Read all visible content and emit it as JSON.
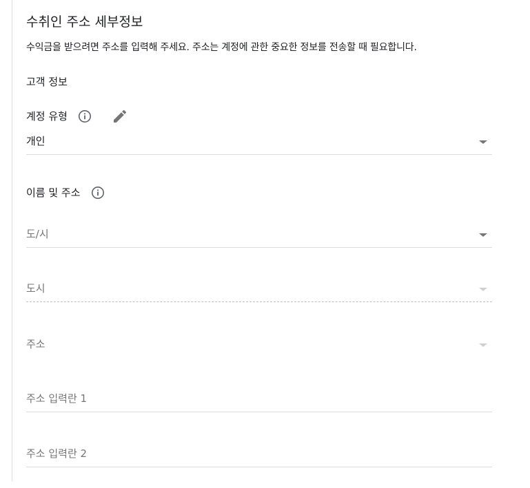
{
  "header": {
    "title": "수취인 주소 세부정보",
    "description": "수익금을 받으려면 주소를 입력해 주세요. 주소는 계정에 관한 중요한 정보를 전송할 때 필요합니다."
  },
  "customer_section": {
    "title": "고객 정보"
  },
  "account_type": {
    "label": "계정 유형",
    "value": "개인"
  },
  "name_address": {
    "label": "이름 및 주소"
  },
  "fields": {
    "province": {
      "placeholder": "도/시"
    },
    "city": {
      "placeholder": "도시"
    },
    "address": {
      "placeholder": "주소"
    },
    "address_line1": {
      "placeholder": "주소 입력란 1"
    },
    "address_line2": {
      "placeholder": "주소 입력란 2"
    }
  },
  "icons": {
    "info": "info-icon",
    "edit": "pencil-icon",
    "dropdown": "chevron-down-icon"
  },
  "colors": {
    "text": "#202124",
    "muted": "#757575",
    "divider": "#dadce0",
    "icon": "#5f6368"
  }
}
